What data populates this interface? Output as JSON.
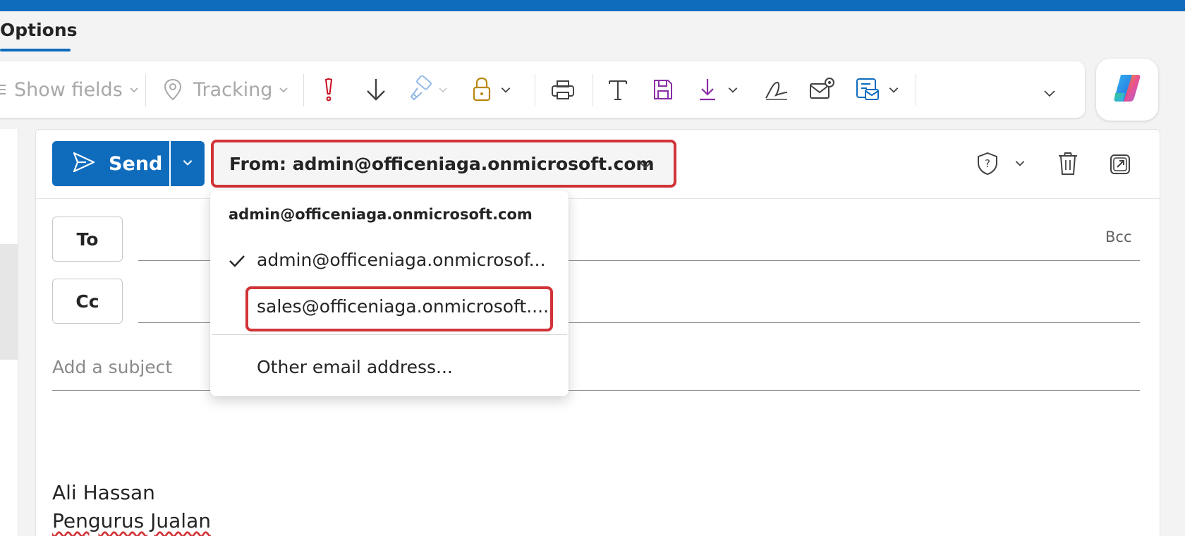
{
  "ribbon": {
    "tab_label": "Options",
    "show_fields_label": "Show fields",
    "tracking_label": "Tracking"
  },
  "compose": {
    "send_label": "Send",
    "from_label": "From: admin@officeniaga.onmicrosoft.com",
    "to_label": "To",
    "cc_label": "Cc",
    "bcc_label": "Bcc",
    "subject_placeholder": "Add a subject",
    "signature": {
      "name": "Ali Hassan",
      "title": "Pengurus Jualan"
    }
  },
  "from_dropdown": {
    "header": "admin@officeniaga.onmicrosoft.com",
    "items": [
      {
        "label": "admin@officeniaga.onmicrosof...",
        "checked": true
      },
      {
        "label": "sales@officeniaga.onmicrosoft....",
        "checked": false
      },
      {
        "label": "Other email address...",
        "checked": false
      }
    ]
  },
  "colors": {
    "brand_blue": "#0f6cbd",
    "highlight_red": "#d13438",
    "importance_red": "#c50f1f",
    "lock_gold": "#b8860b",
    "purple": "#8a2da5"
  },
  "icons": {
    "ribbon": [
      "location-icon",
      "importance-high-icon",
      "importance-low-icon",
      "format-painter-icon",
      "lock-icon",
      "print-icon",
      "text-format-icon",
      "save-icon",
      "download-icon",
      "signature-icon",
      "mail-settings-icon",
      "mail-template-icon",
      "copilot-icon"
    ],
    "header": [
      "sensitivity-icon",
      "delete-icon",
      "pop-out-icon"
    ]
  }
}
